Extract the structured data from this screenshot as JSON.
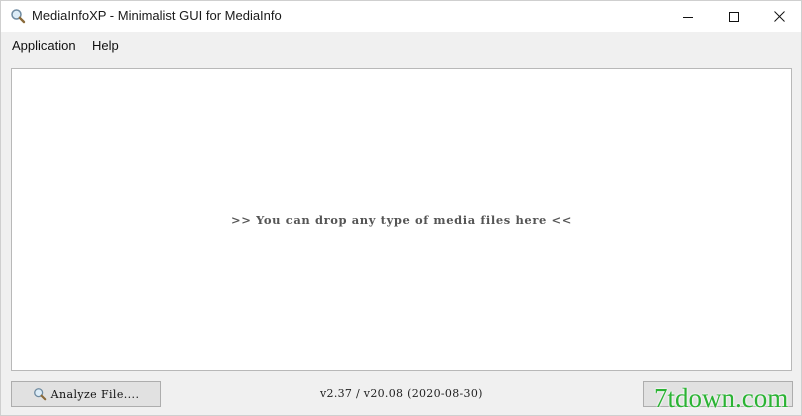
{
  "window": {
    "title": "MediaInfoXP - Minimalist GUI for MediaInfo",
    "icon": "magnifier-icon"
  },
  "menu": {
    "items": [
      {
        "label": "Application"
      },
      {
        "label": "Help"
      }
    ]
  },
  "drop_area": {
    "hint": ">> You can drop any type of media files here <<"
  },
  "footer": {
    "analyze_label": "Analyze File....",
    "version": "v2.37 / v20.08 (2020-08-30)"
  },
  "watermark": {
    "text": "7tdown.com",
    "color": "#2bb334"
  }
}
